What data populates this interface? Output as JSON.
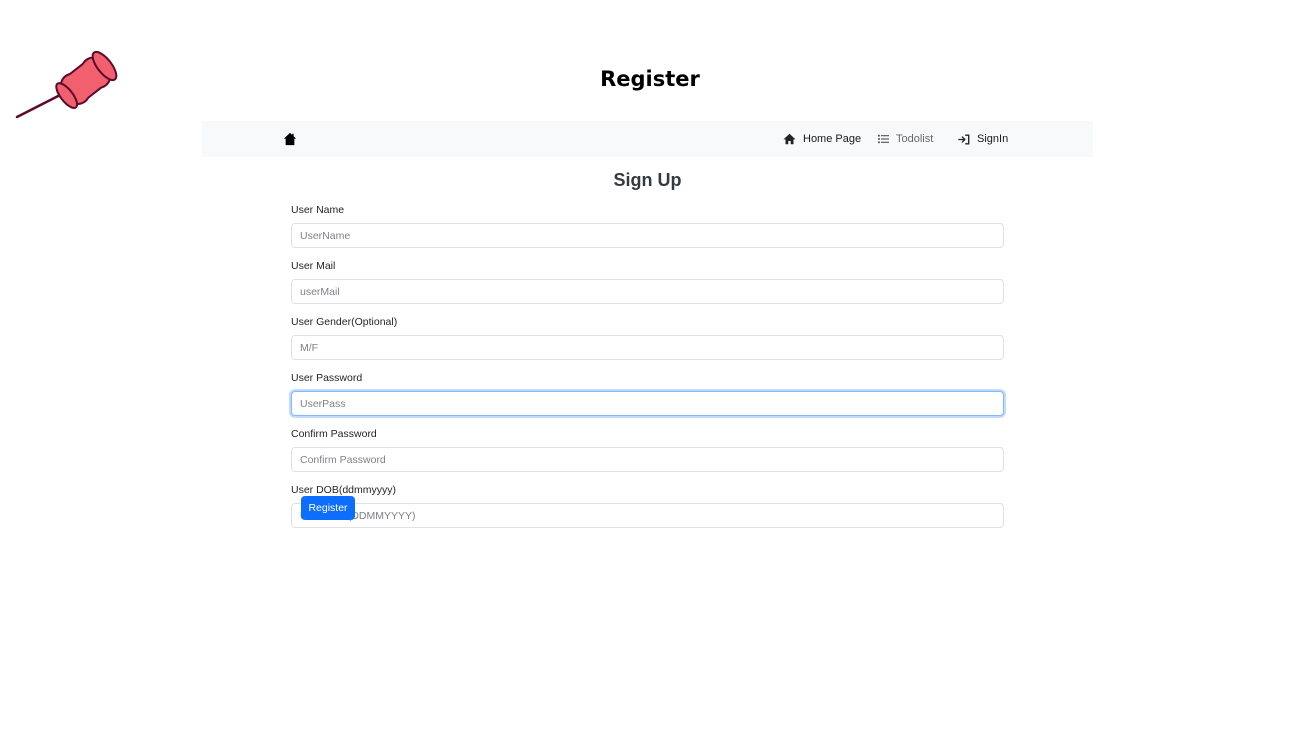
{
  "slide": {
    "title": "Register"
  },
  "navbar": {
    "brand_icon": "house-icon",
    "links": [
      {
        "label": "Home Page",
        "icon": "home-icon"
      },
      {
        "label": "Todolist",
        "icon": "list-icon"
      },
      {
        "label": "SignIn",
        "icon": "sign-in-icon"
      }
    ]
  },
  "form": {
    "heading": "Sign Up",
    "fields": [
      {
        "label": "User Name",
        "placeholder": "UserName"
      },
      {
        "label": "User Mail",
        "placeholder": "userMail"
      },
      {
        "label": "User Gender(Optional)",
        "placeholder": "M/F"
      },
      {
        "label": "User Password",
        "placeholder": "UserPass"
      },
      {
        "label": "Confirm Password",
        "placeholder": "Confirm Password"
      },
      {
        "label": "User DOB(ddmmyyyy)",
        "placeholder": "User DOB(DDMMYYYY)"
      }
    ],
    "submit_label": "Register"
  },
  "colors": {
    "primary": "#0d6efd",
    "navbar_bg": "#f8f9fa",
    "pushpin_fill": "#f0606e",
    "pushpin_outline": "#5c0a2a"
  }
}
